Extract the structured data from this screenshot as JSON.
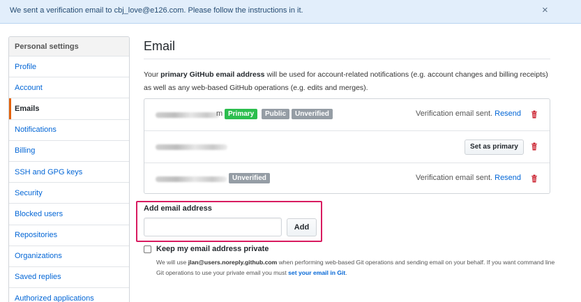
{
  "flash": {
    "message": "We sent a verification email to cbj_love@e126.com. Please follow the instructions in it.",
    "close": "×"
  },
  "sidebar": {
    "heading": "Personal settings",
    "items": [
      {
        "label": "Profile",
        "selected": false
      },
      {
        "label": "Account",
        "selected": false
      },
      {
        "label": "Emails",
        "selected": true
      },
      {
        "label": "Notifications",
        "selected": false
      },
      {
        "label": "Billing",
        "selected": false
      },
      {
        "label": "SSH and GPG keys",
        "selected": false
      },
      {
        "label": "Security",
        "selected": false
      },
      {
        "label": "Blocked users",
        "selected": false
      },
      {
        "label": "Repositories",
        "selected": false
      },
      {
        "label": "Organizations",
        "selected": false
      },
      {
        "label": "Saved replies",
        "selected": false
      },
      {
        "label": "Authorized applications",
        "selected": false
      }
    ]
  },
  "main": {
    "title": "Email",
    "description": {
      "before": "Your ",
      "bold": "primary GitHub email address",
      "after": " will be used for account-related notifications (e.g. account changes and billing receipts) as well as any web-based GitHub operations (e.g. edits and merges)."
    },
    "emails": [
      {
        "email_tail": "m",
        "badges": [
          "Primary",
          "Public",
          "Unverified"
        ],
        "status": "Verification email sent.",
        "resend": "Resend"
      },
      {
        "email_tail": "",
        "badges": [],
        "set_primary": "Set as primary"
      },
      {
        "email_tail": "",
        "badges": [
          "Unverified"
        ],
        "status": "Verification email sent.",
        "resend": "Resend"
      }
    ],
    "add": {
      "label": "Add email address",
      "placeholder": "",
      "button": "Add"
    },
    "private": {
      "label": "Keep my email address private",
      "note_before": "We will use ",
      "note_email": "jlan@users.noreply.github.com",
      "note_middle": " when performing web-based Git operations and sending email on your behalf. If you want command line Git operations to use your private email you must ",
      "note_link": "set your email in Git",
      "note_after": "."
    }
  },
  "colors": {
    "accent_link": "#0366d6",
    "primary_badge": "#2cbe4e",
    "gray_badge": "#959da5",
    "delete_icon": "#cb2431",
    "highlight_box": "#d81b60",
    "selected_marker": "#e36209"
  }
}
